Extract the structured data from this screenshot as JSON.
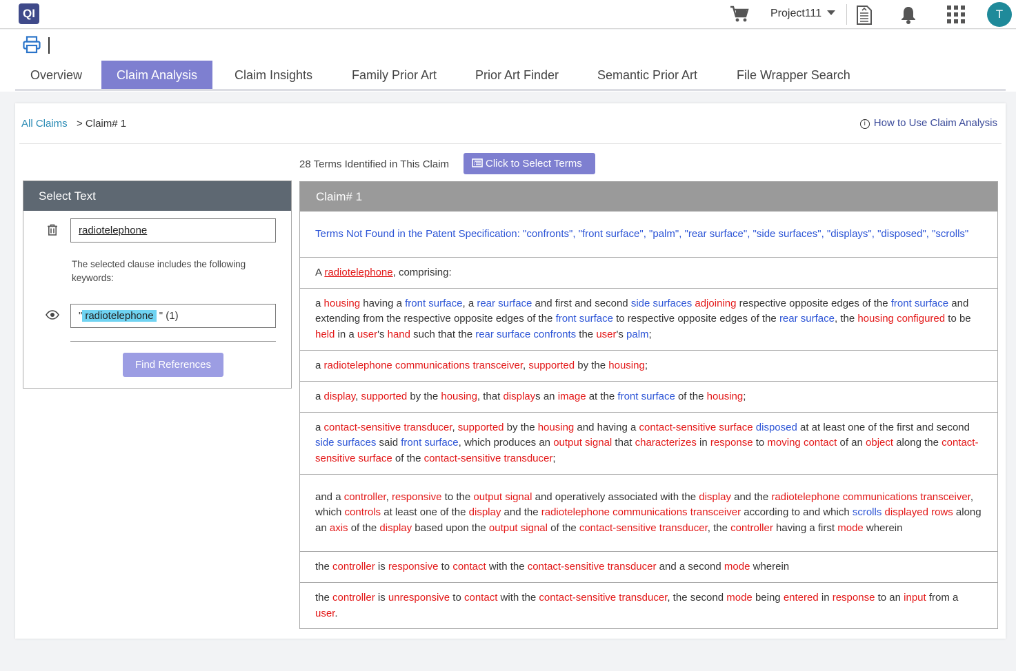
{
  "topbar": {
    "logo_text": "QI",
    "project_name": "Project111",
    "avatar_initial": "T"
  },
  "tabs": [
    {
      "label": "Overview",
      "active": false
    },
    {
      "label": "Claim Analysis",
      "active": true
    },
    {
      "label": "Claim Insights",
      "active": false
    },
    {
      "label": "Family Prior Art",
      "active": false
    },
    {
      "label": "Prior Art Finder",
      "active": false
    },
    {
      "label": "Semantic Prior Art",
      "active": false
    },
    {
      "label": "File Wrapper Search",
      "active": false
    }
  ],
  "breadcrumb": {
    "link": "All Claims",
    "current": "> Claim# 1"
  },
  "help_link": "How to Use Claim Analysis",
  "terms": {
    "count_text": "28 Terms Identified in This Claim",
    "select_button": "Click to Select Terms"
  },
  "select_panel": {
    "title": "Select Text",
    "text_value": "radiotelephone",
    "clause_note": "The selected clause includes the following keywords:",
    "keyword": "radiotelephone",
    "keyword_prefix": "\"",
    "keyword_suffix": " \" (1)",
    "find_button": "Find References"
  },
  "claim": {
    "title": "Claim# 1",
    "not_found": "Terms Not Found in the Patent Specification: \"confronts\", \"front surface\", \"palm\", \"rear surface\", \"side surfaces\", \"displays\", \"disposed\", \"scrolls\"",
    "rows": [
      [
        [
          "n",
          "A "
        ],
        [
          "ru",
          "radiotelephone"
        ],
        [
          "n",
          ", comprising:"
        ]
      ],
      [
        [
          "n",
          "a "
        ],
        [
          "r",
          "housing"
        ],
        [
          "n",
          " having a "
        ],
        [
          "b",
          "front surface"
        ],
        [
          "n",
          ", a "
        ],
        [
          "b",
          "rear surface"
        ],
        [
          "n",
          " and first and second "
        ],
        [
          "b",
          "side surfaces"
        ],
        [
          "n",
          " "
        ],
        [
          "r",
          "adjoining"
        ],
        [
          "n",
          " respective opposite edges of the "
        ],
        [
          "b",
          "front surface"
        ],
        [
          "n",
          " and extending from the respective opposite edges of the "
        ],
        [
          "b",
          "front surface"
        ],
        [
          "n",
          " to respective opposite edges of the "
        ],
        [
          "b",
          "rear surface"
        ],
        [
          "n",
          ", the "
        ],
        [
          "r",
          "housing"
        ],
        [
          "n",
          " "
        ],
        [
          "r",
          "configured"
        ],
        [
          "n",
          " to be "
        ],
        [
          "r",
          "held"
        ],
        [
          "n",
          " in a "
        ],
        [
          "r",
          "user"
        ],
        [
          "n",
          "'s "
        ],
        [
          "r",
          "hand"
        ],
        [
          "n",
          " such that the "
        ],
        [
          "b",
          "rear surface confronts"
        ],
        [
          "n",
          " the "
        ],
        [
          "r",
          "user"
        ],
        [
          "n",
          "'s "
        ],
        [
          "b",
          "palm"
        ],
        [
          "n",
          ";"
        ]
      ],
      [
        [
          "n",
          "a "
        ],
        [
          "r",
          "radiotelephone communications transceiver"
        ],
        [
          "n",
          ", "
        ],
        [
          "r",
          "supported"
        ],
        [
          "n",
          " by the "
        ],
        [
          "r",
          "housing"
        ],
        [
          "n",
          ";"
        ]
      ],
      [
        [
          "n",
          "a "
        ],
        [
          "r",
          "display"
        ],
        [
          "n",
          ", "
        ],
        [
          "r",
          "supported"
        ],
        [
          "n",
          " by the "
        ],
        [
          "r",
          "housing"
        ],
        [
          "n",
          ", that "
        ],
        [
          "r",
          "display"
        ],
        [
          "n",
          "s an "
        ],
        [
          "r",
          "image"
        ],
        [
          "n",
          " at the "
        ],
        [
          "b",
          "front surface"
        ],
        [
          "n",
          " of the "
        ],
        [
          "r",
          "housing"
        ],
        [
          "n",
          ";"
        ]
      ],
      [
        [
          "n",
          "a "
        ],
        [
          "r",
          "contact-sensitive transducer"
        ],
        [
          "n",
          ", "
        ],
        [
          "r",
          "supported"
        ],
        [
          "n",
          " by the "
        ],
        [
          "r",
          "housing"
        ],
        [
          "n",
          " and having a "
        ],
        [
          "r",
          "contact-sensitive surface"
        ],
        [
          "n",
          " "
        ],
        [
          "b",
          "disposed"
        ],
        [
          "n",
          " at at least one of the first and second "
        ],
        [
          "b",
          "side surfaces"
        ],
        [
          "n",
          " said "
        ],
        [
          "b",
          "front surface"
        ],
        [
          "n",
          ", which produces an "
        ],
        [
          "r",
          "output signal"
        ],
        [
          "n",
          " that "
        ],
        [
          "r",
          "characterizes"
        ],
        [
          "n",
          " in "
        ],
        [
          "r",
          "response"
        ],
        [
          "n",
          " to "
        ],
        [
          "r",
          "moving contact"
        ],
        [
          "n",
          " of an "
        ],
        [
          "r",
          "object"
        ],
        [
          "n",
          " along the "
        ],
        [
          "r",
          "contact-sensitive surface"
        ],
        [
          "n",
          " of the "
        ],
        [
          "r",
          "contact-sensitive transducer"
        ],
        [
          "n",
          ";"
        ]
      ],
      [
        [
          "n",
          "and a "
        ],
        [
          "r",
          "controller"
        ],
        [
          "n",
          ", "
        ],
        [
          "r",
          "responsive"
        ],
        [
          "n",
          " to the "
        ],
        [
          "r",
          "output signal"
        ],
        [
          "n",
          " and operatively associated with the "
        ],
        [
          "r",
          "display"
        ],
        [
          "n",
          " and the "
        ],
        [
          "r",
          "radiotelephone communications transceiver"
        ],
        [
          "n",
          ", which "
        ],
        [
          "r",
          "controls"
        ],
        [
          "n",
          " at least one of the "
        ],
        [
          "r",
          "display"
        ],
        [
          "n",
          " and the "
        ],
        [
          "r",
          "radiotelephone communications transceiver"
        ],
        [
          "n",
          " according to and which "
        ],
        [
          "b",
          "scrolls"
        ],
        [
          "n",
          " "
        ],
        [
          "r",
          "displayed rows"
        ],
        [
          "n",
          " along an "
        ],
        [
          "r",
          "axis"
        ],
        [
          "n",
          " of the "
        ],
        [
          "r",
          "display"
        ],
        [
          "n",
          " based upon the "
        ],
        [
          "r",
          "output signal"
        ],
        [
          "n",
          " of the "
        ],
        [
          "r",
          "contact-sensitive transducer"
        ],
        [
          "n",
          ", the "
        ],
        [
          "r",
          "controller"
        ],
        [
          "n",
          " having a first "
        ],
        [
          "r",
          "mode"
        ],
        [
          "n",
          " wherein"
        ]
      ],
      [
        [
          "n",
          "the "
        ],
        [
          "r",
          "controller"
        ],
        [
          "n",
          " is "
        ],
        [
          "r",
          "responsive"
        ],
        [
          "n",
          " to "
        ],
        [
          "r",
          "contact"
        ],
        [
          "n",
          " with the "
        ],
        [
          "r",
          "contact-sensitive transducer"
        ],
        [
          "n",
          " and a second "
        ],
        [
          "r",
          "mode"
        ],
        [
          "n",
          " wherein"
        ]
      ],
      [
        [
          "n",
          "the "
        ],
        [
          "r",
          "controller"
        ],
        [
          "n",
          " is "
        ],
        [
          "r",
          "unresponsive"
        ],
        [
          "n",
          " to "
        ],
        [
          "r",
          "contact"
        ],
        [
          "n",
          " with the "
        ],
        [
          "r",
          "contact-sensitive transducer"
        ],
        [
          "n",
          ", the second "
        ],
        [
          "r",
          "mode"
        ],
        [
          "n",
          " being "
        ],
        [
          "r",
          "entered"
        ],
        [
          "n",
          " in "
        ],
        [
          "r",
          "response"
        ],
        [
          "n",
          " to an "
        ],
        [
          "r",
          "input"
        ],
        [
          "n",
          " from a "
        ],
        [
          "r",
          "user"
        ],
        [
          "n",
          "."
        ]
      ]
    ]
  },
  "colors": {
    "accent": "#7e7fd0",
    "term_found": "#e31818",
    "term_not_found": "#2d55d6",
    "link": "#2a8bb5"
  },
  "icons": [
    "cart-icon",
    "caret-down-icon",
    "document-icon",
    "bell-icon",
    "apps-grid-icon",
    "print-icon",
    "trash-icon",
    "eye-icon",
    "list-icon",
    "info-icon"
  ]
}
